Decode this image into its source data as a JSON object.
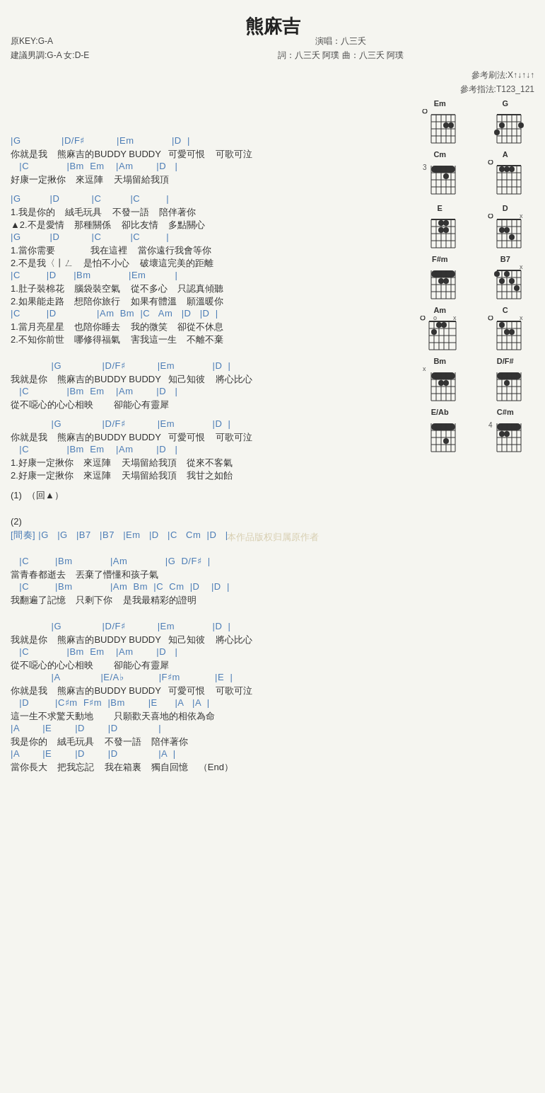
{
  "title": "熊麻吉",
  "meta": {
    "key": "原KEY:G-A",
    "suggestion": "建議男調:G-A 女:D-E",
    "singer": "演唱：八三夭",
    "lyricist": "詞：八三夭 阿璞  曲：八三夭 阿璞"
  },
  "ref": {
    "strum": "參考刷法:X↑↓↑↓↑",
    "finger": "參考指法:T123_121"
  },
  "chords": [
    {
      "name": "Em",
      "fret": "",
      "dots": [
        [
          2,
          4
        ],
        [
          2,
          5
        ]
      ],
      "open": [
        1
      ],
      "mute": [],
      "bass_fret": null
    },
    {
      "name": "G",
      "fret": "",
      "dots": [
        [
          1,
          2
        ],
        [
          1,
          3
        ],
        [
          1,
          4
        ],
        [
          1,
          5
        ],
        [
          1,
          6
        ]
      ],
      "open": [],
      "mute": [],
      "bass_fret": null
    },
    {
      "name": "Cm",
      "fret": "3",
      "dots": [
        [
          1,
          2
        ],
        [
          1,
          3
        ],
        [
          1,
          4
        ],
        [
          1,
          5
        ],
        [
          2,
          4
        ]
      ],
      "open": [],
      "mute": [],
      "bass_fret": null
    },
    {
      "name": "A",
      "fret": "",
      "dots": [
        [
          1,
          2
        ],
        [
          1,
          3
        ],
        [
          1,
          4
        ]
      ],
      "open": [
        1
      ],
      "mute": [],
      "bass_fret": null
    },
    {
      "name": "E",
      "fret": "",
      "dots": [
        [
          1,
          3
        ],
        [
          1,
          4
        ],
        [
          1,
          5
        ],
        [
          2,
          3
        ],
        [
          2,
          4
        ]
      ],
      "open": [],
      "mute": [],
      "bass_fret": null
    },
    {
      "name": "D",
      "fret": "",
      "dots": [
        [
          1,
          2
        ],
        [
          1,
          3
        ],
        [
          2,
          4
        ]
      ],
      "open": [
        1
      ],
      "mute": [],
      "bass_fret": null
    },
    {
      "name": "F#m",
      "fret": "",
      "dots": [
        [
          1,
          1
        ],
        [
          1,
          2
        ],
        [
          1,
          3
        ],
        [
          1,
          4
        ],
        [
          1,
          5
        ],
        [
          1,
          6
        ],
        [
          2,
          3
        ],
        [
          2,
          4
        ]
      ],
      "open": [],
      "mute": [],
      "bass_fret": null
    },
    {
      "name": "B7",
      "fret": "",
      "dots": [
        [
          1,
          2
        ],
        [
          1,
          4
        ],
        [
          2,
          1
        ],
        [
          2,
          3
        ],
        [
          2,
          5
        ]
      ],
      "open": [],
      "mute": [],
      "bass_fret": null
    },
    {
      "name": "Am",
      "fret": "",
      "dots": [
        [
          1,
          2
        ],
        [
          1,
          3
        ],
        [
          2,
          2
        ]
      ],
      "open": [
        1,
        6
      ],
      "mute": [],
      "bass_fret": null
    },
    {
      "name": "C",
      "fret": "",
      "dots": [
        [
          1,
          2
        ],
        [
          2,
          4
        ],
        [
          2,
          5
        ]
      ],
      "open": [
        1
      ],
      "mute": [],
      "bass_fret": null
    },
    {
      "name": "Bm",
      "fret": "",
      "dots": [
        [
          1,
          1
        ],
        [
          1,
          2
        ],
        [
          1,
          3
        ],
        [
          1,
          4
        ],
        [
          1,
          5
        ],
        [
          2,
          3
        ],
        [
          2,
          4
        ]
      ],
      "open": [],
      "mute": [],
      "bass_fret": null
    },
    {
      "name": "D/F#",
      "fret": "",
      "dots": [
        [
          1,
          1
        ],
        [
          1,
          2
        ],
        [
          1,
          3
        ],
        [
          1,
          4
        ],
        [
          1,
          5
        ],
        [
          1,
          6
        ],
        [
          2,
          3
        ]
      ],
      "open": [],
      "mute": [],
      "bass_fret": null
    },
    {
      "name": "E/Ab",
      "fret": "",
      "dots": [
        [
          1,
          1
        ],
        [
          1,
          2
        ],
        [
          1,
          3
        ],
        [
          1,
          4
        ],
        [
          1,
          5
        ],
        [
          1,
          6
        ],
        [
          3,
          4
        ]
      ],
      "open": [],
      "mute": [],
      "bass_fret": null
    },
    {
      "name": "C#m",
      "fret": "4",
      "dots": [
        [
          1,
          1
        ],
        [
          1,
          2
        ],
        [
          1,
          3
        ],
        [
          1,
          4
        ],
        [
          1,
          5
        ],
        [
          2,
          2
        ],
        [
          2,
          3
        ]
      ],
      "open": [],
      "mute": [],
      "bass_fret": null
    }
  ],
  "content": [
    {
      "type": "chord",
      "text": "|G              |D/F♯           |Em             |D  |"
    },
    {
      "type": "lyric",
      "text": "你就是我    熊麻吉的BUDDY BUDDY   可愛可恨    可歌可泣"
    },
    {
      "type": "chord",
      "text": "   |C             |Bm  Em    |Am        |D   |"
    },
    {
      "type": "lyric",
      "text": "好康一定揪你    來逗陣    天塌留給我頂"
    },
    {
      "type": "break"
    },
    {
      "type": "chord",
      "text": "|G          |D           |C          |C         |"
    },
    {
      "type": "lyric",
      "text": "1.我是你的    絨毛玩具    不發一語    陪伴著你"
    },
    {
      "type": "lyric",
      "text": "▲2.不是愛情    那種關係    卻比友情    多點關心"
    },
    {
      "type": "chord",
      "text": "|G          |D           |C          |C         |"
    },
    {
      "type": "lyric",
      "text": "1.當你需要              我在這裡    當你遠行我會等你"
    },
    {
      "type": "lyric",
      "text": "2.不是我〈丨ㄥ    是怕不小心    破壞這完美的距離"
    },
    {
      "type": "chord",
      "text": "|C         |D      |Bm             |Em          |"
    },
    {
      "type": "lyric",
      "text": "1.肚子裝棉花    腦袋裝空氣    從不多心    只認真傾聽"
    },
    {
      "type": "lyric",
      "text": "2.如果能走路    想陪你旅行    如果有體溫    願溫暖你"
    },
    {
      "type": "chord",
      "text": "|C         |D              |Am  Bm  |C   Am   |D   |D  |"
    },
    {
      "type": "lyric",
      "text": "1.當月亮星星    也陪你睡去    我的微笑    卻從不休息"
    },
    {
      "type": "lyric",
      "text": "2.不知你前世    哪修得福氣    害我這一生    不離不棄"
    },
    {
      "type": "break"
    },
    {
      "type": "break"
    },
    {
      "type": "chord",
      "text": "              |G              |D/F♯           |Em             |D  |"
    },
    {
      "type": "lyric",
      "text": "我就是你    熊麻吉的BUDDY BUDDY   知己知彼    將心比心"
    },
    {
      "type": "chord",
      "text": "   |C             |Bm  Em    |Am        |D   |"
    },
    {
      "type": "lyric",
      "text": "從不噁心的心心相映        卻能心有靈犀"
    },
    {
      "type": "break"
    },
    {
      "type": "chord",
      "text": "              |G              |D/F♯           |Em             |D  |"
    },
    {
      "type": "lyric",
      "text": "你就是我    熊麻吉的BUDDY BUDDY   可愛可恨    可歌可泣"
    },
    {
      "type": "chord",
      "text": "   |C             |Bm  Em    |Am        |D   |"
    },
    {
      "type": "lyric",
      "text": "1.好康一定揪你    來逗陣    天塌留給我頂    從來不客氣"
    },
    {
      "type": "lyric",
      "text": "2.好康一定揪你    來逗陣    天塌留給我頂    我甘之如飴"
    },
    {
      "type": "break"
    },
    {
      "type": "lyric",
      "text": "(1)  （回▲）"
    },
    {
      "type": "break"
    },
    {
      "type": "break"
    },
    {
      "type": "lyric",
      "text": "(2)"
    },
    {
      "type": "chord",
      "text": "[間奏] |G   |G   |B7   |B7   |Em   |D   |C   Cm  |D   |"
    },
    {
      "type": "break"
    },
    {
      "type": "break"
    },
    {
      "type": "chord",
      "text": "   |C         |Bm             |Am             |G  D/F♯  |"
    },
    {
      "type": "lyric",
      "text": "當青春都逝去    丟棄了懵懂和孩子氣"
    },
    {
      "type": "chord",
      "text": "   |C         |Bm             |Am  Bm  |C  Cm  |D    |D  |"
    },
    {
      "type": "lyric",
      "text": "我翻遍了記憶    只剩下你    是我最精彩的證明"
    },
    {
      "type": "break"
    },
    {
      "type": "break"
    },
    {
      "type": "chord",
      "text": "              |G              |D/F♯           |Em             |D  |"
    },
    {
      "type": "lyric",
      "text": "我就是你    熊麻吉的BUDDY BUDDY   知己知彼    將心比心"
    },
    {
      "type": "chord",
      "text": "   |C             |Bm  Em    |Am        |D   |"
    },
    {
      "type": "lyric",
      "text": "從不噁心的心心相映        卻能心有靈犀"
    },
    {
      "type": "chord",
      "text": "              |A              |E/A♭            |F♯m            |E  |"
    },
    {
      "type": "lyric",
      "text": "你就是我    熊麻吉的BUDDY BUDDY   可愛可恨    可歌可泣"
    },
    {
      "type": "chord",
      "text": "   |D         |C♯m  F♯m  |Bm        |E      |A   |A  |"
    },
    {
      "type": "lyric",
      "text": "這一生不求驚天動地        只願歡天喜地的相依為命"
    },
    {
      "type": "chord",
      "text": "|A        |E        |D        |D              |"
    },
    {
      "type": "lyric",
      "text": "我是你的    絨毛玩具    不發一語    陪伴著你"
    },
    {
      "type": "chord",
      "text": "|A        |E        |D        |D              |A  |"
    },
    {
      "type": "lyric",
      "text": "當你長大    把我忘記    我在箱裏    獨自回憶    （End）"
    }
  ]
}
